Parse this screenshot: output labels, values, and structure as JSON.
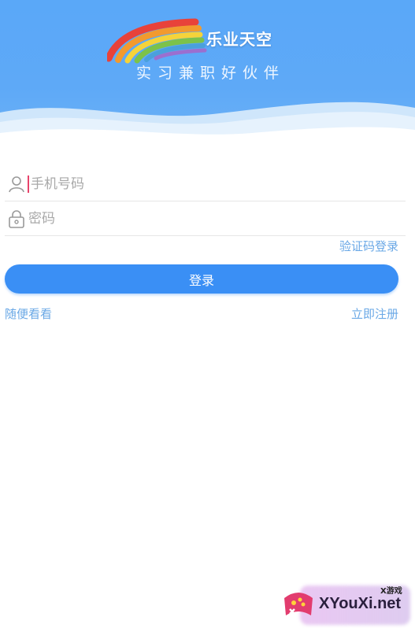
{
  "header": {
    "brand": "乐业天空",
    "slogan": "实习兼职好伙伴"
  },
  "form": {
    "phone_placeholder": "手机号码",
    "password_placeholder": "密码",
    "sms_login_link": "验证码登录",
    "login_button": "登录",
    "browse_link": "随便看看",
    "register_link": "立即注册"
  },
  "icons": {
    "user": "user-icon",
    "lock": "lock-icon"
  },
  "colors": {
    "header_bg": "#5aa8f8",
    "primary_button": "#3a8ff5",
    "link": "#6aa8e6",
    "caret": "#e8436b"
  },
  "watermark": {
    "site": "XYouXi.net",
    "small": "X游戏"
  }
}
